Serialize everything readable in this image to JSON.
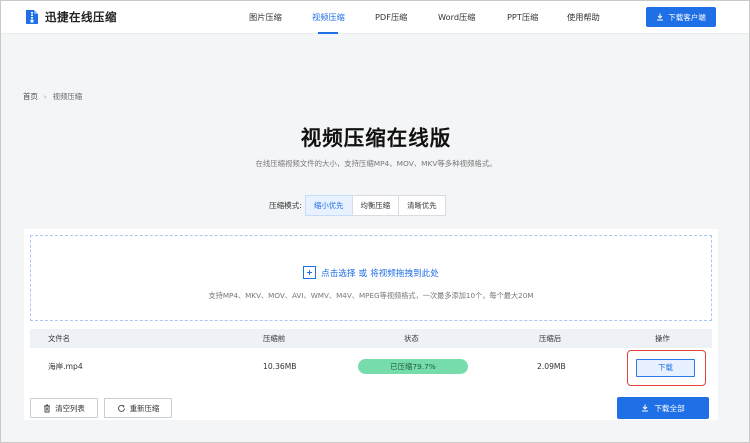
{
  "header": {
    "logo_text": "迅捷在线压缩",
    "nav": [
      "图片压缩",
      "视频压缩",
      "PDF压缩",
      "Word压缩",
      "PPT压缩",
      "使用帮助"
    ],
    "active_nav": "视频压缩",
    "client_button": "下载客户端"
  },
  "breadcrumb": {
    "home": "首页",
    "current": "视频压缩"
  },
  "page": {
    "title": "视频压缩在线版",
    "subtitle": "在线压缩视频文件的大小，支持压缩MP4、MOV、MKV等多种视频格式。"
  },
  "mode": {
    "label": "压缩模式:",
    "options": [
      "缩小优先",
      "均衡压缩",
      "清晰优先"
    ],
    "selected": "缩小优先"
  },
  "upload": {
    "cta_prefix": "点击选择",
    "cta_or": "或",
    "cta_suffix": "将视频拖拽到此处",
    "hint": "支持MP4、MKV、MOV、AVI、WMV、M4V、MPEG等视频格式，一次最多添加10个，每个最大20M"
  },
  "table": {
    "headers": {
      "name": "文件名",
      "before": "压缩前",
      "status": "状态",
      "after": "压缩后",
      "action": "操作"
    },
    "rows": [
      {
        "name": "海岸.mp4",
        "before": "10.36MB",
        "status": "已压缩79.7%",
        "after": "2.09MB",
        "action": "下载"
      }
    ]
  },
  "actions": {
    "clear": "清空列表",
    "recompress": "重新压缩",
    "download_all": "下载全部"
  },
  "colors": {
    "primary": "#1f6fe6",
    "success": "#77dcab",
    "highlight": "#e0463b"
  },
  "icons": [
    "zip-file-icon",
    "download-icon",
    "plus-icon",
    "trash-icon",
    "refresh-icon",
    "chevron-right-icon"
  ]
}
